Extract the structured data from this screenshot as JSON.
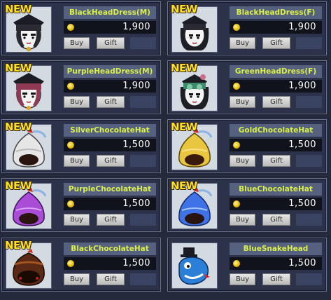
{
  "items": [
    {
      "name": "BlackHeadDress(M)",
      "price": "1,900",
      "new": true,
      "icon": "black-headdress-male-icon"
    },
    {
      "name": "BlackHeadDress(F)",
      "price": "1,900",
      "new": true,
      "icon": "black-headdress-female-icon"
    },
    {
      "name": "PurpleHeadDress(M)",
      "price": "1,900",
      "new": true,
      "icon": "purple-headdress-male-icon"
    },
    {
      "name": "GreenHeadDress(F)",
      "price": "1,900",
      "new": true,
      "icon": "green-headdress-female-icon"
    },
    {
      "name": "SilverChocolateHat",
      "price": "1,500",
      "new": true,
      "icon": "silver-chocolate-hat-icon"
    },
    {
      "name": "GoldChocolateHat",
      "price": "1,500",
      "new": true,
      "icon": "gold-chocolate-hat-icon"
    },
    {
      "name": "PurpleChocolateHat",
      "price": "1,500",
      "new": true,
      "icon": "purple-chocolate-hat-icon"
    },
    {
      "name": "BlueChocolateHat",
      "price": "1,500",
      "new": true,
      "icon": "blue-chocolate-hat-icon"
    },
    {
      "name": "BlackChocolateHat",
      "price": "1,500",
      "new": true,
      "icon": "black-chocolate-hat-icon"
    },
    {
      "name": "BlueSnakeHead",
      "price": "1,500",
      "new": false,
      "icon": "blue-snake-head-icon"
    }
  ],
  "labels": {
    "new": "NEW",
    "buy": "Buy",
    "gift": "Gift"
  },
  "colors": {
    "name_text": "#d9f04a",
    "new_badge": "#ffe21a",
    "silver": "#e4e4e4",
    "gold": "#e9c640",
    "purple": "#a94cd8",
    "blue": "#3f72e6",
    "black": "#3a1f12"
  }
}
